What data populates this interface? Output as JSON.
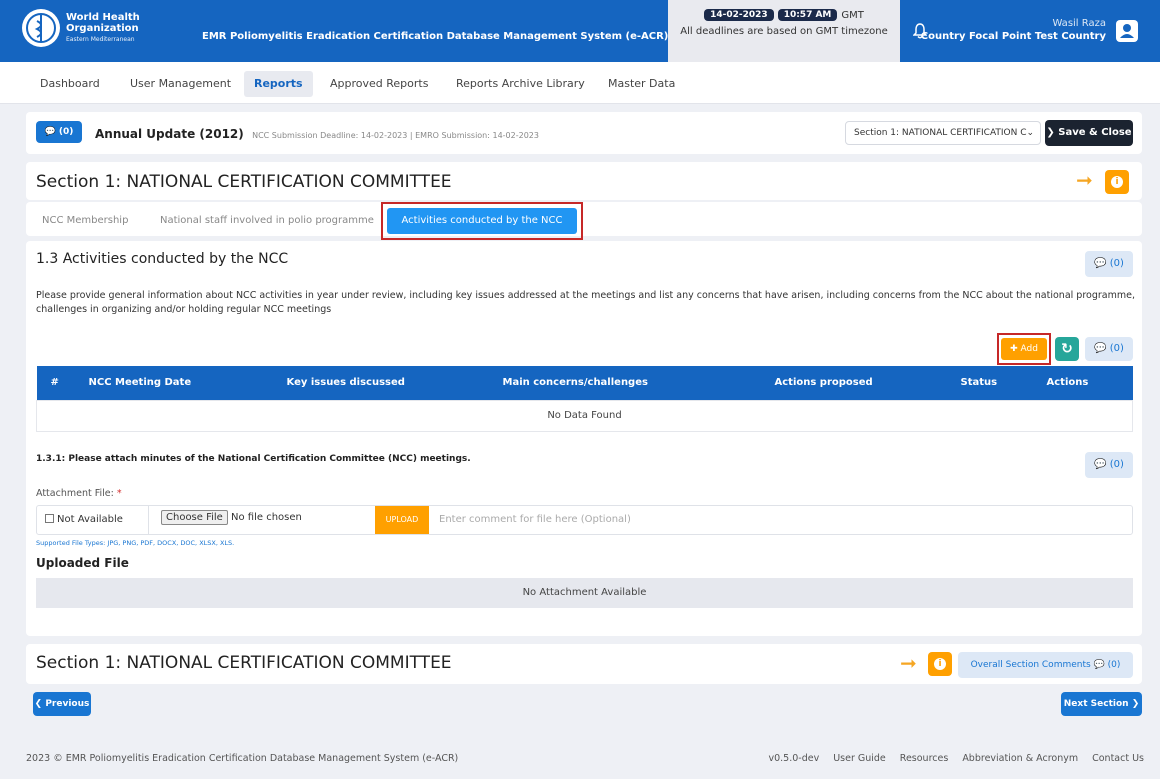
{
  "header": {
    "org_line1": "World Health",
    "org_line2": "Organization",
    "org_line3": "Eastern Mediterranean",
    "app_title": "EMR Poliomyelitis Eradication Certification Database Management System (e-ACR)",
    "date": "14-02-2023",
    "time": "10:57 AM",
    "tz": "GMT",
    "deadline_note": "All deadlines are based on GMT timezone",
    "user_name": "Wasil Raza",
    "user_role": "Country Focal Point Test Country"
  },
  "nav": {
    "items": [
      "Dashboard",
      "User Management",
      "Reports",
      "Approved Reports",
      "Reports Archive Library",
      "Master Data"
    ],
    "active": "Reports"
  },
  "report_bar": {
    "comments": "(0)",
    "title": "Annual Update (2012)",
    "deadlines": "NCC Submission Deadline: 14-02-2023 | EMRO Submission: 14-02-2023",
    "section_select": "Section 1: NATIONAL CERTIFICATION C",
    "save_label": "Save & Close"
  },
  "section": {
    "title": "Section 1: NATIONAL CERTIFICATION COMMITTEE",
    "tabs": [
      "NCC Membership",
      "National staff involved in polio programme",
      "Activities conducted by the NCC"
    ]
  },
  "activities": {
    "heading": "1.3 Activities conducted by the NCC",
    "comments": "(0)",
    "description": "Please provide general information about NCC activities in year under review, including key issues addressed at the meetings and list any concerns that have arisen, including concerns from the NCC about the national programme, challenges in organizing and/or holding regular NCC meetings",
    "add_label": "Add",
    "table_comments": "(0)",
    "columns": [
      "#",
      "NCC Meeting Date",
      "Key issues discussed",
      "Main concerns/challenges",
      "Actions proposed",
      "Status",
      "Actions"
    ],
    "empty_text": "No Data Found"
  },
  "attachment": {
    "title": "1.3.1: Please attach minutes of the National Certification Committee (NCC) meetings.",
    "comments": "(0)",
    "label": "Attachment File:",
    "required_mark": "*",
    "not_available": "Not Available",
    "choose_file": "Choose File",
    "no_file": "No file chosen",
    "upload": "UPLOAD",
    "comment_placeholder": "Enter comment for file here (Optional)",
    "supported": "Supported File Types: JPG, PNG, PDF, DOCX, DOC, XLSX, XLS.",
    "uploaded_heading": "Uploaded File",
    "no_attachment": "No Attachment Available"
  },
  "bottom": {
    "section_title": "Section 1: NATIONAL CERTIFICATION COMMITTEE",
    "overall_comments": "Overall Section Comments",
    "overall_count": "(0)",
    "previous": "Previous",
    "next": "Next Section"
  },
  "footer": {
    "copyright": "2023 © EMR Poliomyelitis Eradication Certification Database Management System (e-ACR)",
    "version": "v0.5.0-dev",
    "links": [
      "User Guide",
      "Resources",
      "Abbreviation & Acronym",
      "Contact Us"
    ]
  },
  "colors": {
    "primary": "#1565c0",
    "accent": "#ffa000",
    "highlight": "#c62828"
  }
}
